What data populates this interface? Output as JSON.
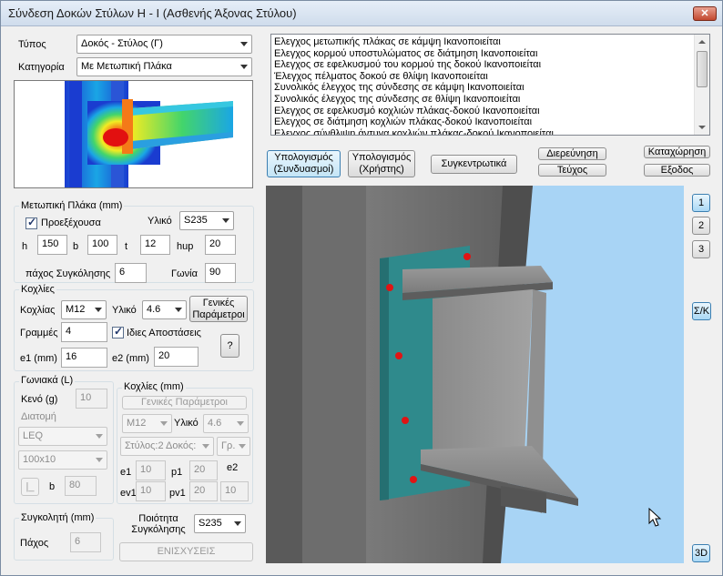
{
  "window": {
    "title": "Σύνδεση Δοκών Στύλων Η - Ι (Ασθενής Άξονας Στύλου)",
    "close_label": "✕"
  },
  "left": {
    "type_label": "Τύπος",
    "type_value": "Δοκός - Στύλος (Γ)",
    "category_label": "Κατηγορία",
    "category_value": "Με Μετωπική Πλάκα"
  },
  "plate": {
    "group_label": "Μετωπική Πλάκα (mm)",
    "protruding_label": "Προεξέχουσα",
    "material_label": "Υλικό",
    "material_value": "S235",
    "h_label": "h",
    "h_value": "150",
    "b_label": "b",
    "b_value": "100",
    "t_label": "t",
    "t_value": "12",
    "hup_label": "hup",
    "hup_value": "20",
    "weld_label": "πάχος Συγκόλησης",
    "weld_value": "6",
    "angle_label": "Γωνία",
    "angle_value": "90"
  },
  "bolts": {
    "group_label": "Κοχλίες",
    "bolt_label": "Κοχλίας",
    "bolt_value": "M12",
    "material_label": "Υλικό",
    "material_value": "4.6",
    "general_button": "Γενικές Παράμετροι",
    "rows_label": "Γραμμές",
    "rows_value": "4",
    "same_dist_label": "Ιδιες Αποστάσεις",
    "e1_label": "e1 (mm)",
    "e1_value": "16",
    "e2_label": "e2 (mm)",
    "e2_value": "20",
    "help_button": "?"
  },
  "angles": {
    "group_label": "Γωνιακά (L)",
    "gap_label": "Κενό (g)",
    "gap_value": "10",
    "section_label": "Διατομή",
    "section_type_value": "LEQ",
    "section_size_value": "100x10",
    "flip_button": "|_",
    "b_label": "b",
    "b_value": "80",
    "bolts_group_label": "Κοχλίες (mm)",
    "general_button": "Γενικές Παράμετροι",
    "bolt_value": "M12",
    "material_label": "Υλικό",
    "material_value": "4.6",
    "column_combo": "Στύλος:2 Δοκός:",
    "gr_combo": "Γρ.",
    "e1_label": "e1",
    "e1_value": "10",
    "p1_label": "p1",
    "p1_value": "20",
    "e2_label": "e2",
    "ev1_label": "ev1",
    "ev1_value": "10",
    "pv1_label": "pv1",
    "pv1_value": "20",
    "e2_value": "10"
  },
  "weld": {
    "group_label": "Συγκολητή (mm)",
    "thickness_label": "Πάχος",
    "thickness_value": "6",
    "quality_label": "Ποιότητα Συγκόλησης",
    "quality_value": "S235",
    "reinforce_button": "ΕΝΙΣΧΥΣΕΙΣ"
  },
  "results": [
    "Ελεγχος μετωπικής πλάκας σε κάμψη Ικανοποιείται",
    "Ελεγχος κορμού υποστυλώματος σε διάτμηση Ικανοποιείται",
    "Ελεγχος σε εφελκυσμού του κορμού της δοκού Ικανοποιείται",
    "Έλεγχος πέλματος δοκού σε θλίψη Ικανοποιείται",
    "Συνολικός έλεγχος της σύνδεσης σε κάμψη Ικανοποιείται",
    "Συνολικός έλεγχος της σύνδεσης σε θλίψη Ικανοποιείται",
    "Ελεγχος σε εφελκυσμό κοχλιών πλάκας-δοκού Ικανοποιείται",
    "Ελεγχος σε διάτμηση κοχλιών πλάκας-δοκού  Ικανοποιείται",
    "Ελεγχος σύνθλιψη άντυγα κοχλιών πλάκας-δοκού Ικανοποιείται"
  ],
  "actions": {
    "calc_combo": "Υπολογισμός (Συνδυασμοί)",
    "calc_user": "Υπολογισμός (Χρήστης)",
    "summary": "Συγκεντρωτικά",
    "explore": "Διερεύνηση",
    "booklet": "Τεύχος",
    "register": "Καταχώρηση",
    "exit": "Εξοδος"
  },
  "view": {
    "btn1": "1",
    "btn2": "2",
    "btn3": "3",
    "sk": "Σ/Κ",
    "btn3d": "3D"
  }
}
